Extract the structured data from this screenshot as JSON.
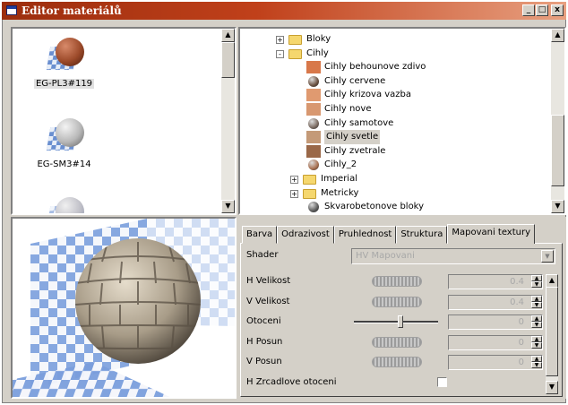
{
  "window": {
    "title": "Editor materiálů",
    "buttons": [
      "_",
      "□",
      "x"
    ]
  },
  "materials": [
    {
      "label": "EG-PL3#119",
      "selected": true,
      "swatch": "#9c4a2a"
    },
    {
      "label": "EG-SM3#14",
      "selected": false,
      "swatch": "#b8b8b8"
    }
  ],
  "tree": [
    {
      "label": "Bloky",
      "type": "folder",
      "expander": "+"
    },
    {
      "label": "Cihly",
      "type": "folder",
      "expander": "-"
    },
    {
      "label": "Cihly behounove zdivo",
      "type": "item",
      "swatch": "#d8784a"
    },
    {
      "label": "Cihly cervene",
      "type": "item",
      "swatch": "#6a5040"
    },
    {
      "label": "Cihly krizova vazba",
      "type": "item",
      "swatch": "#e09a70"
    },
    {
      "label": "Cihly nove",
      "type": "item",
      "swatch": "#d89870"
    },
    {
      "label": "Cihly samotove",
      "type": "item",
      "swatch": "#7a6a60"
    },
    {
      "label": "Cihly svetle",
      "type": "item",
      "swatch": "#c49a78",
      "selected": true
    },
    {
      "label": "Cihly zvetrale",
      "type": "item",
      "swatch": "#9a6848"
    },
    {
      "label": "Cihly_2",
      "type": "item",
      "swatch": "#a87050"
    },
    {
      "label": "Imperial",
      "type": "folder",
      "expander": "+"
    },
    {
      "label": "Metricky",
      "type": "folder",
      "expander": "+"
    },
    {
      "label": "Skvarobetonove bloky",
      "type": "item",
      "swatch": "#5a5a5a"
    }
  ],
  "tabs": [
    "Barva",
    "Odrazivost",
    "Pruhlednost",
    "Struktura",
    "Mapovani textury"
  ],
  "active_tab": "Mapovani textury",
  "shader": {
    "label": "Shader",
    "value": "HV Mapovani"
  },
  "params": [
    {
      "label": "H Velikost",
      "value": "0.4",
      "control": "dial"
    },
    {
      "label": "V Velikost",
      "value": "0.4",
      "control": "dial"
    },
    {
      "label": "Otoceni",
      "value": "0",
      "control": "slider",
      "position": 0.55
    },
    {
      "label": "H Posun",
      "value": "0",
      "control": "dial"
    },
    {
      "label": "V Posun",
      "value": "0",
      "control": "dial"
    },
    {
      "label": "H Zrcadlove otoceni",
      "value": "",
      "control": "checkbox"
    }
  ],
  "colors": {
    "title_start": "#9c2e0e",
    "title_end": "#e8a080",
    "face": "#d4d0c8",
    "checker": "#6a8fd0"
  }
}
